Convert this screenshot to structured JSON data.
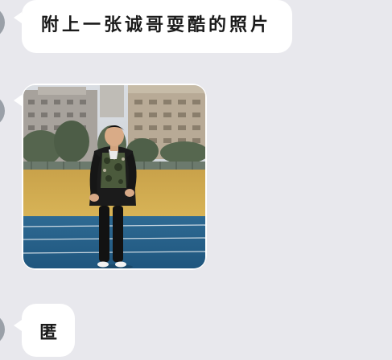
{
  "messages": [
    {
      "type": "text",
      "text": "附上一张诚哥耍酷的照片"
    },
    {
      "type": "image",
      "description": ""
    },
    {
      "type": "text",
      "text": "匿"
    }
  ],
  "colors": {
    "background": "#e8e8ed",
    "bubble": "#ffffff",
    "avatar": "#9aa0a8"
  },
  "icons": {
    "avatar": "avatar-icon"
  }
}
